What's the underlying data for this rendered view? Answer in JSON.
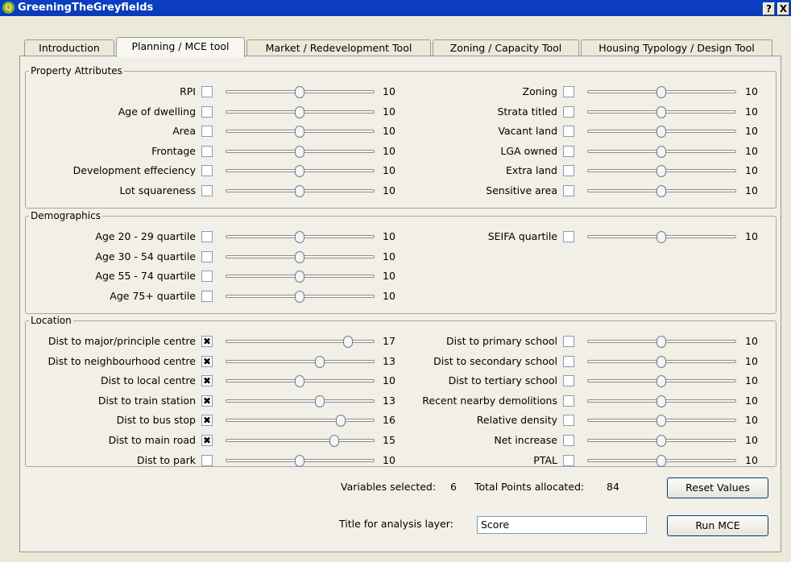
{
  "window": {
    "title": "GreeningTheGreyfields",
    "help_label": "?",
    "close_label": "X"
  },
  "tabs": [
    {
      "label": "Introduction"
    },
    {
      "label": "Planning / MCE tool"
    },
    {
      "label": "Market / Redevelopment  Tool"
    },
    {
      "label": "Zoning / Capacity Tool"
    },
    {
      "label": "Housing Typology / Design Tool"
    }
  ],
  "active_tab": "Planning / MCE tool",
  "slider_range_assumed": [
    0,
    20
  ],
  "groups": {
    "property": {
      "title": "Property Attributes",
      "left": [
        {
          "label": "RPI",
          "checked": false,
          "value": 10
        },
        {
          "label": "Age of dwelling",
          "checked": false,
          "value": 10
        },
        {
          "label": "Area",
          "checked": false,
          "value": 10
        },
        {
          "label": "Frontage",
          "checked": false,
          "value": 10
        },
        {
          "label": "Development effeciency",
          "checked": false,
          "value": 10
        },
        {
          "label": "Lot squareness",
          "checked": false,
          "value": 10
        }
      ],
      "right": [
        {
          "label": "Zoning",
          "checked": false,
          "value": 10
        },
        {
          "label": "Strata titled",
          "checked": false,
          "value": 10
        },
        {
          "label": "Vacant land",
          "checked": false,
          "value": 10
        },
        {
          "label": "LGA owned",
          "checked": false,
          "value": 10
        },
        {
          "label": "Extra land",
          "checked": false,
          "value": 10
        },
        {
          "label": "Sensitive area",
          "checked": false,
          "value": 10
        }
      ]
    },
    "demographics": {
      "title": "Demographics",
      "left": [
        {
          "label": "Age 20 - 29 quartile",
          "checked": false,
          "value": 10
        },
        {
          "label": "Age 30 - 54 quartile",
          "checked": false,
          "value": 10
        },
        {
          "label": "Age 55 - 74 quartile",
          "checked": false,
          "value": 10
        },
        {
          "label": "Age 75+ quartile",
          "checked": false,
          "value": 10
        }
      ],
      "right": [
        {
          "label": "SEIFA quartile",
          "checked": false,
          "value": 10
        }
      ]
    },
    "location": {
      "title": "Location",
      "left": [
        {
          "label": "Dist to major/principle centre",
          "checked": true,
          "value": 17
        },
        {
          "label": "Dist to neighbourhood centre",
          "checked": true,
          "value": 13
        },
        {
          "label": "Dist to local centre",
          "checked": true,
          "value": 10
        },
        {
          "label": "Dist to train station",
          "checked": true,
          "value": 13
        },
        {
          "label": "Dist to bus stop",
          "checked": true,
          "value": 16
        },
        {
          "label": "Dist to main road",
          "checked": true,
          "value": 15
        },
        {
          "label": "Dist to park",
          "checked": false,
          "value": 10
        }
      ],
      "right": [
        {
          "label": "Dist to primary school",
          "checked": false,
          "value": 10
        },
        {
          "label": "Dist to secondary school",
          "checked": false,
          "value": 10
        },
        {
          "label": "Dist to tertiary school",
          "checked": false,
          "value": 10
        },
        {
          "label": "Recent nearby demolitions",
          "checked": false,
          "value": 10
        },
        {
          "label": "Relative density",
          "checked": false,
          "value": 10
        },
        {
          "label": "Net increase",
          "checked": false,
          "value": 10
        },
        {
          "label": "PTAL",
          "checked": false,
          "value": 10
        }
      ]
    }
  },
  "summary": {
    "variables_label": "Variables selected:",
    "variables_value": "6",
    "points_label": "Total Points allocated:",
    "points_value": "84",
    "reset_label": "Reset Values"
  },
  "analysis": {
    "title_label": "Title for analysis layer:",
    "title_value": "Score",
    "run_label": "Run MCE"
  }
}
